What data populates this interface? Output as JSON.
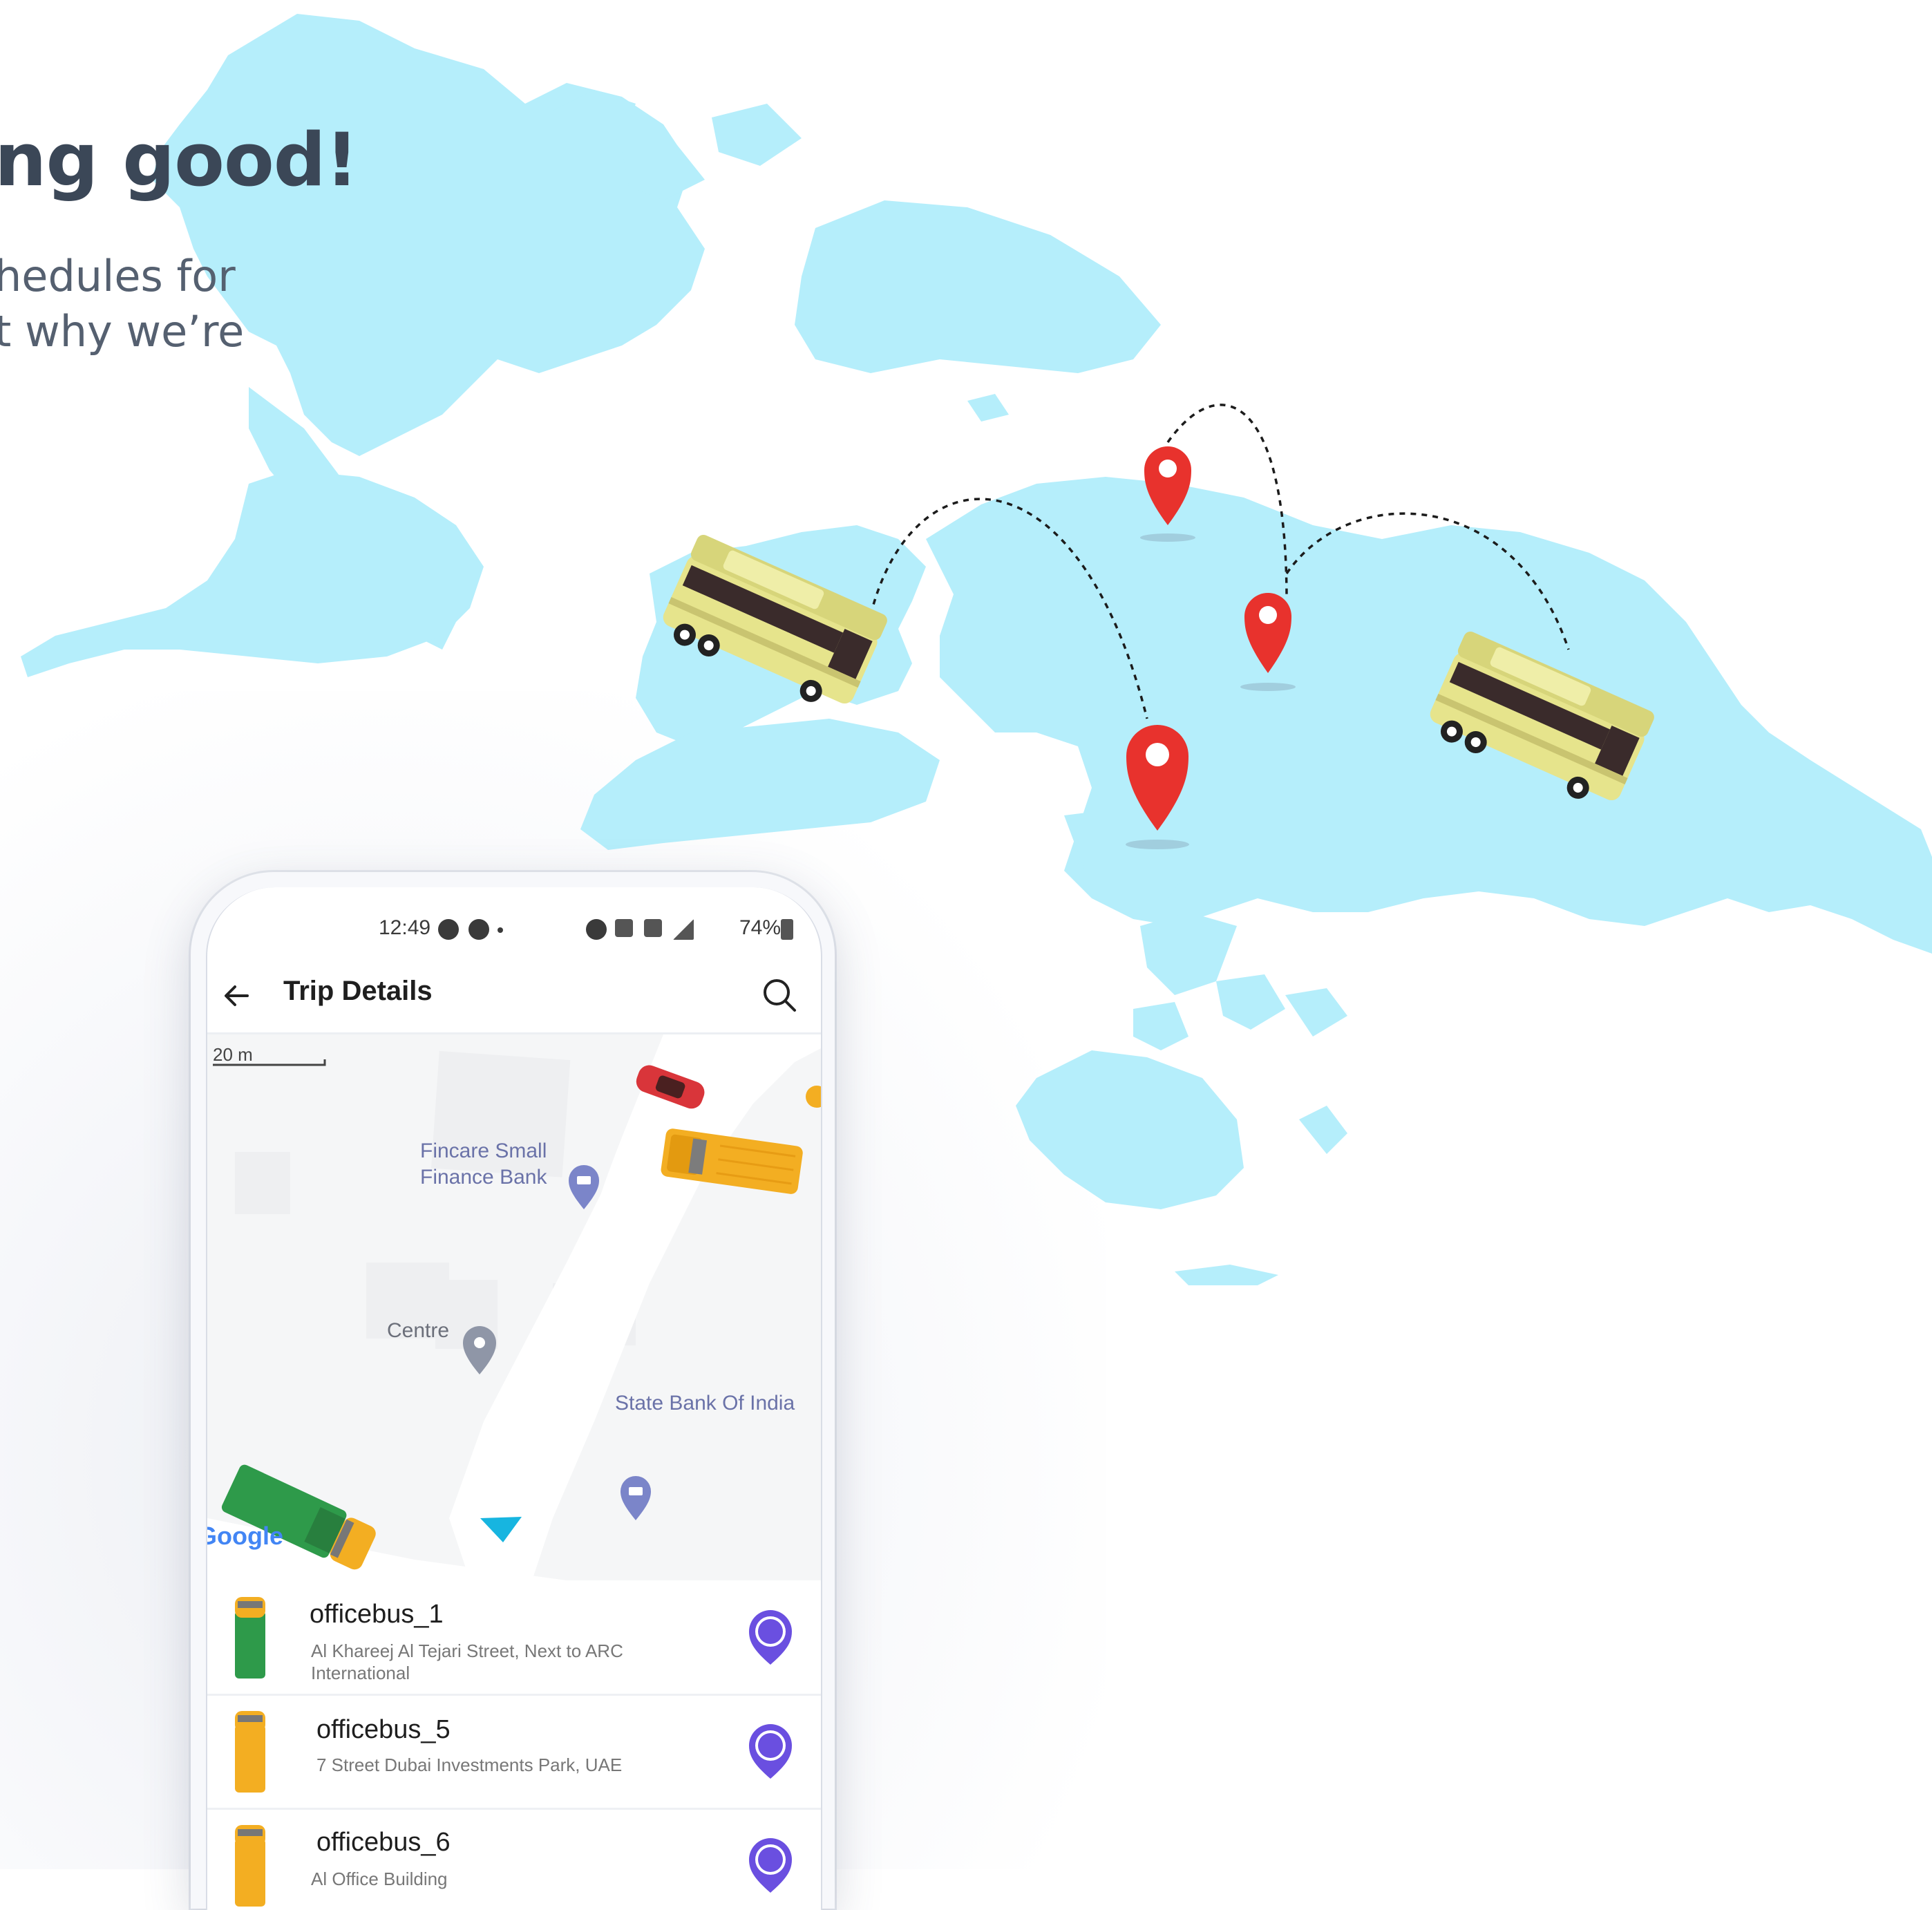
{
  "hero": {
    "title": "ng good!",
    "subtitle_line1": "hedules for",
    "subtitle_line2": "t why we’re"
  },
  "phone": {
    "status_bar": {
      "time": "12:49",
      "battery": "74%"
    },
    "app_bar": {
      "title": "Trip Details"
    },
    "map": {
      "scale": "20 m",
      "labels": {
        "fincare_line1": "Fincare Small",
        "fincare_line2": "Finance Bank",
        "centre": "Centre",
        "sbi": "State Bank Of India"
      },
      "attribution": "Google"
    },
    "bus_list": [
      {
        "name": "officebus_1",
        "address": "Al Khareej Al Tejari Street, Next to ARC International",
        "color": "#2e9a4a"
      },
      {
        "name": "officebus_5",
        "address": "7 Street Dubai Investments Park, UAE",
        "color": "#f3ae22"
      },
      {
        "name": "officebus_6",
        "address": "Al Office Building",
        "color": "#f3ae22"
      }
    ]
  },
  "colors": {
    "map_land": "#b5eefb",
    "pin": "#e8322d",
    "bus_body": "#d7d57a",
    "locate_icon": "#6a4fe0",
    "heading": "#3b4757"
  }
}
